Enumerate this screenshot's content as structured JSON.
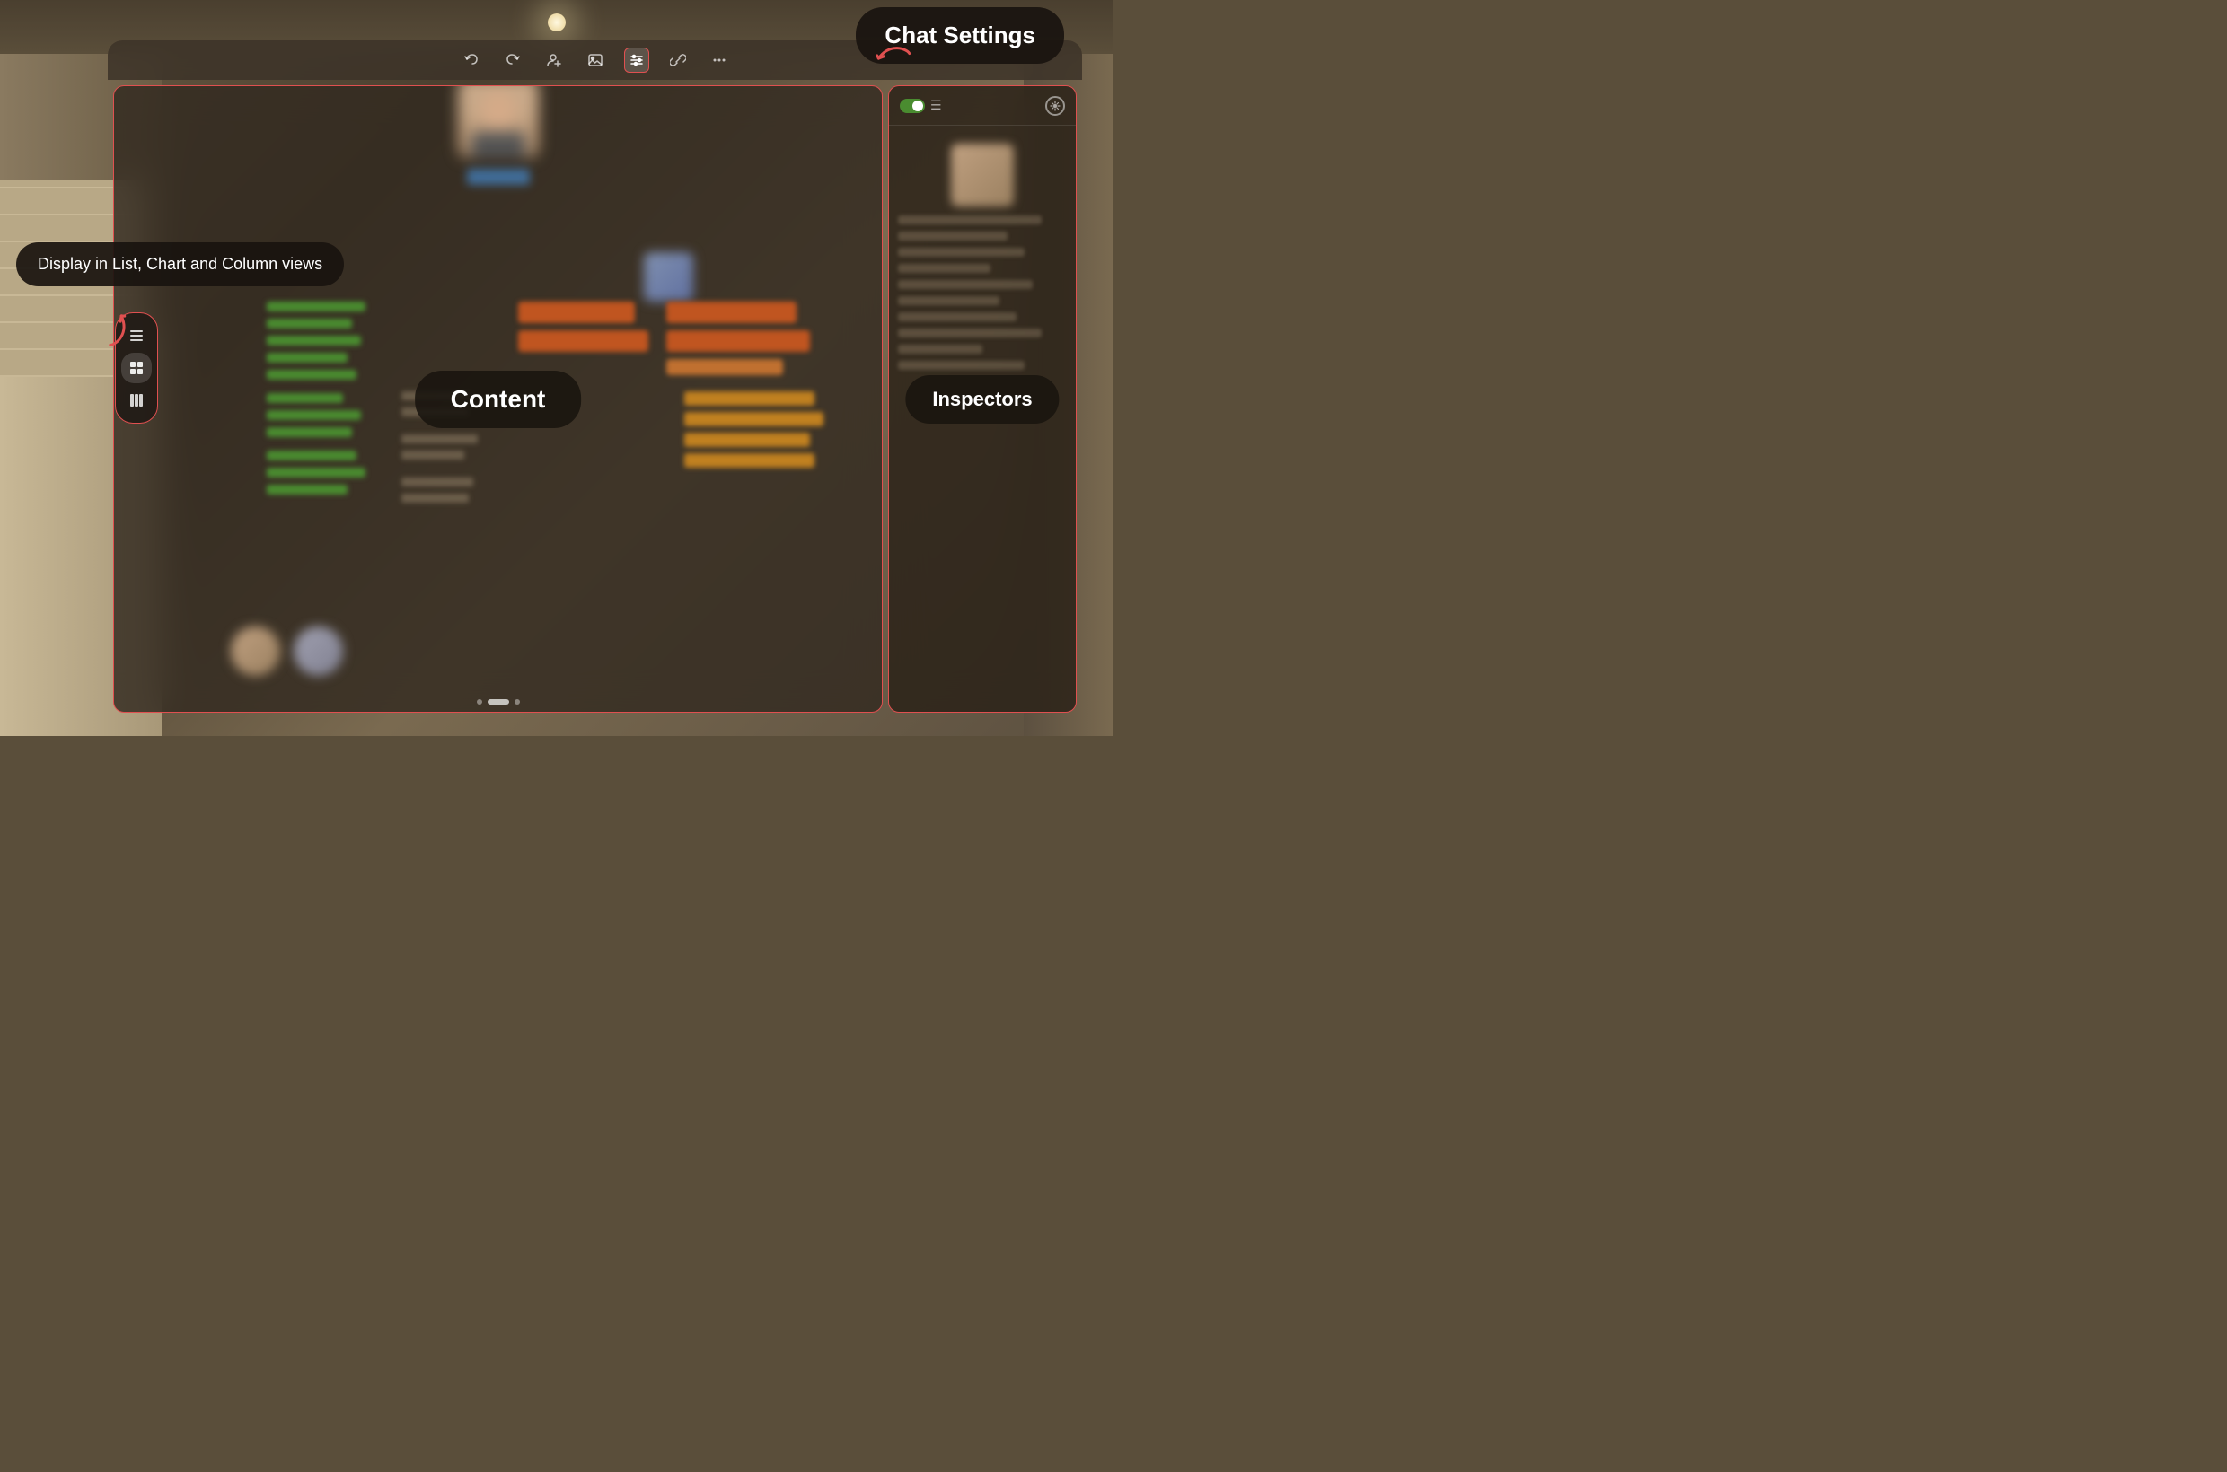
{
  "background": {
    "color": "#5a4e3a"
  },
  "toolbar": {
    "buttons": [
      {
        "name": "undo",
        "icon": "↩",
        "label": "Undo"
      },
      {
        "name": "redo",
        "icon": "↪",
        "label": "Redo"
      },
      {
        "name": "person-plus",
        "icon": "⑂",
        "label": "Add Person"
      },
      {
        "name": "image",
        "icon": "⊟",
        "label": "Insert Image"
      },
      {
        "name": "chat-settings",
        "icon": "≡",
        "label": "Chat Settings",
        "active": true
      },
      {
        "name": "link",
        "icon": "⊞",
        "label": "Link"
      },
      {
        "name": "more",
        "icon": "•••",
        "label": "More"
      }
    ]
  },
  "chat_settings_tooltip": {
    "label": "Chat Settings"
  },
  "display_tooltip": {
    "label": "Display in List, Chart and Column views"
  },
  "view_selector": {
    "buttons": [
      {
        "name": "list-view",
        "icon": "☰",
        "label": "List View"
      },
      {
        "name": "chart-view",
        "icon": "⊞",
        "label": "Chart View",
        "selected": true
      },
      {
        "name": "column-view",
        "icon": "⊟",
        "label": "Column View"
      }
    ]
  },
  "content_panel": {
    "label": "Content"
  },
  "inspectors_panel": {
    "label": "Inspectors"
  },
  "page_indicator": {
    "dots": [
      {
        "active": false
      },
      {
        "active": true
      },
      {
        "active": false
      }
    ]
  }
}
